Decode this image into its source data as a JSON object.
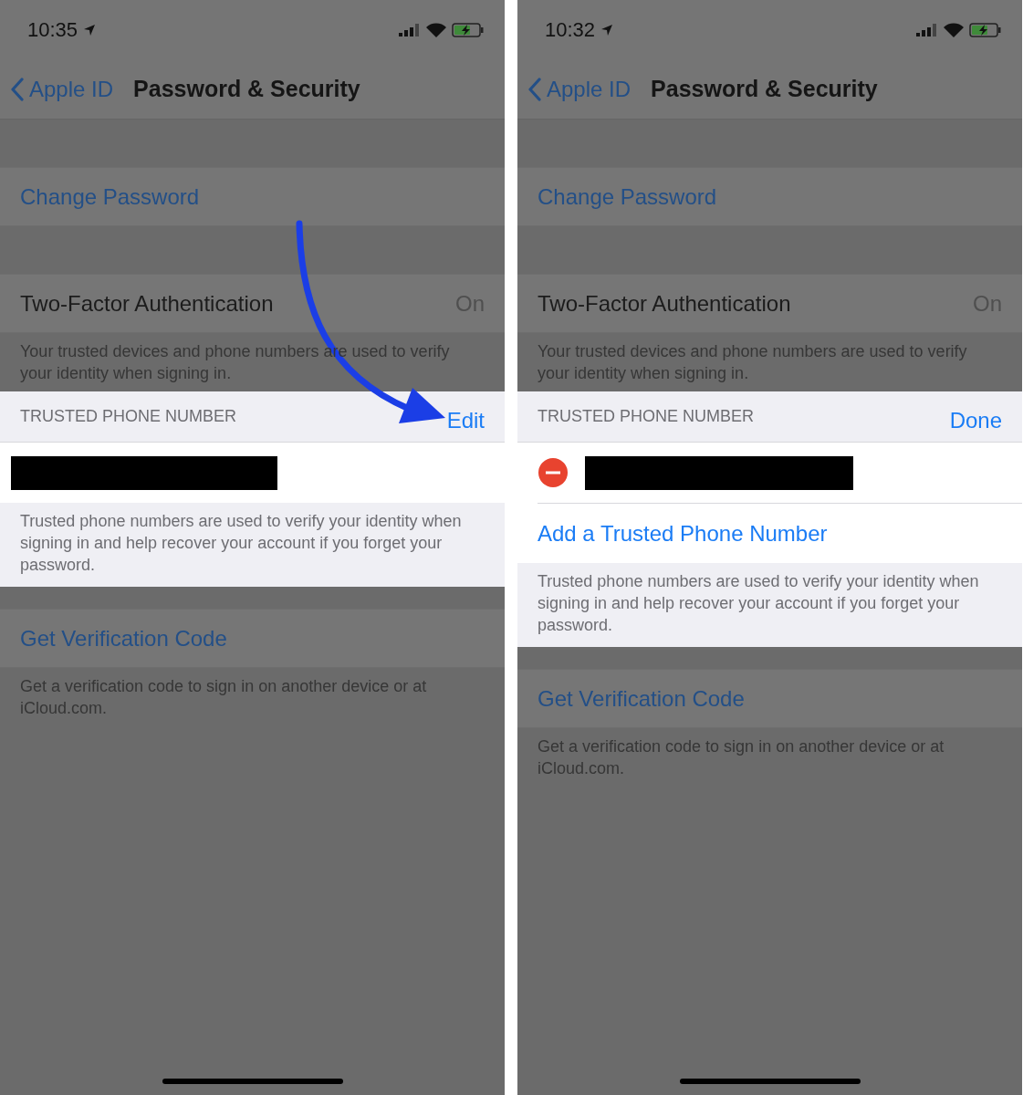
{
  "screens": [
    {
      "status_bar": {
        "time": "10:35"
      },
      "nav": {
        "back": "Apple ID",
        "title": "Password & Security"
      },
      "change_password": "Change Password",
      "two_factor": {
        "label": "Two-Factor Authentication",
        "value": "On",
        "footer": "Your trusted devices and phone numbers are used to verify your identity when signing in."
      },
      "trusted": {
        "header": "TRUSTED PHONE NUMBER",
        "action": "Edit",
        "editing": false,
        "footer": "Trusted phone numbers are used to verify your identity when signing in and help recover your account if you forget your password."
      },
      "verification": {
        "label": "Get Verification Code",
        "footer": "Get a verification code to sign in on another device or at iCloud.com."
      },
      "arrow": true
    },
    {
      "status_bar": {
        "time": "10:32"
      },
      "nav": {
        "back": "Apple ID",
        "title": "Password & Security"
      },
      "change_password": "Change Password",
      "two_factor": {
        "label": "Two-Factor Authentication",
        "value": "On",
        "footer": "Your trusted devices and phone numbers are used to verify your identity when signing in."
      },
      "trusted": {
        "header": "TRUSTED PHONE NUMBER",
        "action": "Done",
        "editing": true,
        "add": "Add a Trusted Phone Number",
        "footer": "Trusted phone numbers are used to verify your identity when signing in and help recover your account if you forget your password."
      },
      "verification": {
        "label": "Get Verification Code",
        "footer": "Get a verification code to sign in on another device or at iCloud.com."
      }
    }
  ]
}
